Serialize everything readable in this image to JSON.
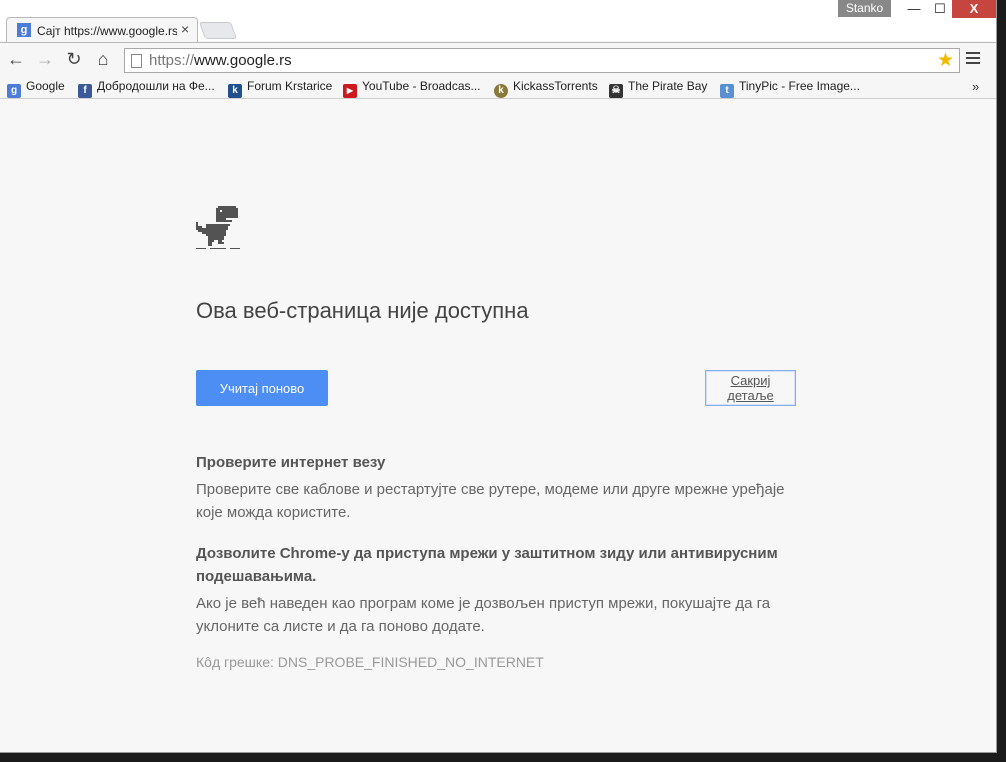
{
  "window": {
    "user": "Stanko",
    "min_glyph": "—",
    "max_glyph": "☐",
    "close_glyph": "X"
  },
  "tab": {
    "favicon": "g",
    "title": "Сајт https://www.google.rs",
    "close_glyph": "×"
  },
  "toolbar": {
    "back_glyph": "←",
    "forward_glyph": "→",
    "reload_glyph": "↻",
    "home_glyph": "⌂",
    "url_scheme": "https://",
    "url_host": "www.google.rs",
    "star_glyph": "★"
  },
  "bookmarks": {
    "items": [
      {
        "label": "Google",
        "icon": "google-icon",
        "glyph": "g",
        "color": "#4d7cd8"
      },
      {
        "label": "Добродошли на Фе...",
        "icon": "facebook-icon",
        "glyph": "f",
        "color": "#3b5998"
      },
      {
        "label": "Forum Krstarice",
        "icon": "krstarica-icon",
        "glyph": "k",
        "color": "#1f4f8f"
      },
      {
        "label": "YouTube - Broadcas...",
        "icon": "youtube-icon",
        "glyph": "▶",
        "color": "#cc181e"
      },
      {
        "label": "KickassTorrents",
        "icon": "kickass-icon",
        "glyph": "k",
        "color": "#8a7a3a"
      },
      {
        "label": "The Pirate Bay",
        "icon": "piratebay-icon",
        "glyph": "☠",
        "color": "#333333"
      },
      {
        "label": "TinyPic - Free Image...",
        "icon": "tinypic-icon",
        "glyph": "t",
        "color": "#5a8fd0"
      }
    ],
    "more_glyph": "»"
  },
  "page": {
    "heading": "Ова веб-страница није доступна",
    "reload_label": "Учитај поново",
    "details_label": "Сакриј детаље",
    "suggestion1_title": "Проверите интернет везу",
    "suggestion1_body": "Проверите све каблове и рестартујте све рутере, модеме или друге мрежне уређаје које можда користите.",
    "suggestion2_title": "Дозволите Chrome-у да приступа мрежи у заштитном зиду или антивирусним подешавањима.",
    "suggestion2_body": "Ако је већ наведен као програм коме је дозвољен приступ мрежи, покушајте да га уклоните са листе и да га поново додате.",
    "error_code": "Кôд грешке: DNS_PROBE_FINISHED_NO_INTERNET"
  },
  "colors": {
    "accent": "#4d8ef4",
    "close_red": "#c6453f",
    "star": "#f1b800"
  }
}
